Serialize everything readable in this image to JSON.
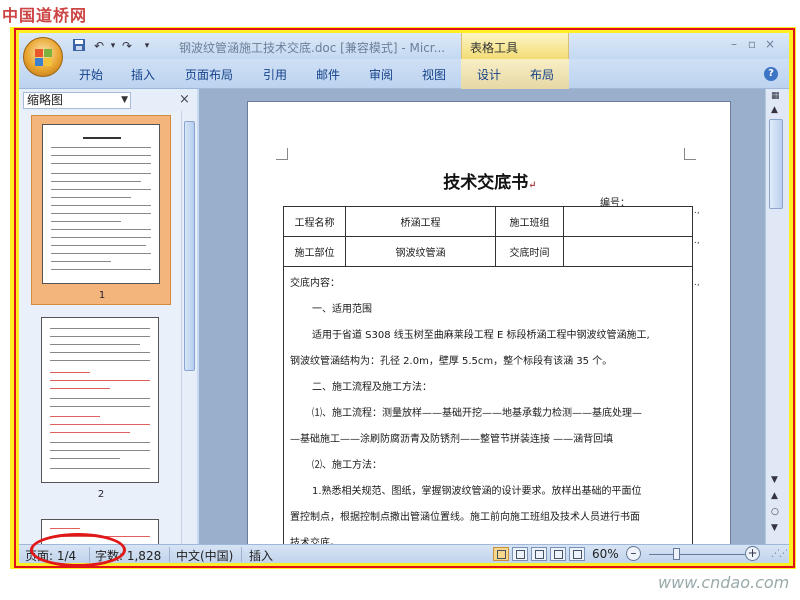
{
  "watermarks": {
    "top": "中国道桥网",
    "bottom": "www.cndao.com"
  },
  "titlebar": {
    "title": "钢波纹管涵施工技术交底.doc [兼容模式] - Micr...",
    "context_tab": "表格工具",
    "quick_access": {
      "save": "save-icon",
      "undo": "↶",
      "redo": "↷",
      "more": "▾"
    },
    "controls": {
      "minimize": "–",
      "restore": "▫",
      "close": "×"
    }
  },
  "ribbon": {
    "tabs": [
      "开始",
      "插入",
      "页面布局",
      "引用",
      "邮件",
      "审阅",
      "视图",
      "设计",
      "布局"
    ],
    "help": "?"
  },
  "nav_pane": {
    "view_select": "缩略图",
    "close": "×",
    "thumbnails": [
      {
        "number": "1"
      },
      {
        "number": "2"
      }
    ]
  },
  "document": {
    "title": "技术交底书",
    "title_mark": "↵",
    "serial_label": "编号：",
    "table": {
      "row1": [
        "工程名称",
        "桥涵工程",
        "施工班组",
        ""
      ],
      "row2": [
        "施工部位",
        "钢波纹管涵",
        "交底时间",
        ""
      ],
      "content_label": "交底内容：",
      "paragraphs": [
        {
          "text": "一、适用范围",
          "indent": true
        },
        {
          "text": "适用于省道 S308 线玉树至曲麻莱段工程 E 标段桥涵工程中钢波纹管涵施工,",
          "indent": true
        },
        {
          "text": "钢波纹管涵结构为：孔径 2.0m，壁厚 5.5cm，整个标段有该涵 35 个。",
          "indent": false
        },
        {
          "text": "二、施工流程及施工方法：",
          "indent": true
        },
        {
          "text": "⑴、施工流程：测量放样——基础开挖——地基承载力检测——基底处理—",
          "indent": true
        },
        {
          "text": "—基础施工——涂刷防腐沥青及防锈剂——整管节拼装连接 ——涵背回填",
          "indent": false
        },
        {
          "text": "⑵、施工方法：",
          "indent": true
        },
        {
          "text": "1.熟悉相关规范、图纸，掌握钢波纹管涵的设计要求。放样出基础的平面位",
          "indent": true
        },
        {
          "text": "置控制点，根据控制点撒出管涵位置线。施工前向施工班组及技术人员进行书面",
          "indent": false
        },
        {
          "text": "技术交底。",
          "indent": false
        }
      ]
    }
  },
  "status_bar": {
    "page": "页面: 1/4",
    "words": "字数: 1,828",
    "language": "中文(中国)",
    "mode": "插入",
    "zoom": "60%",
    "zoom_level_percent": 60
  },
  "colors": {
    "highlight_frame": "#e0101a",
    "outer_band": "#ffee22",
    "annotation": "#e01818"
  }
}
